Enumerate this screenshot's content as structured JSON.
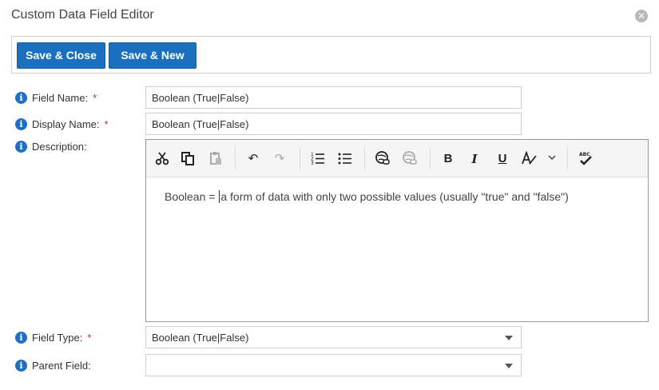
{
  "dialog": {
    "title": "Custom Data Field Editor",
    "close_icon": "close-circle-icon"
  },
  "toolbar": {
    "save_close_label": "Save & Close",
    "save_new_label": "Save & New"
  },
  "form": {
    "field_name": {
      "label": "Field Name:",
      "required_mark": "*",
      "value": "Boolean (True|False)"
    },
    "display_name": {
      "label": "Display Name:",
      "required_mark": "*",
      "value": "Boolean (True|False)"
    },
    "description": {
      "label": "Description:",
      "content_before_caret": "Boolean = ",
      "content_after_caret": "a form of data with only two possible values (usually \"true\" and \"false\")"
    },
    "field_type": {
      "label": "Field Type:",
      "required_mark": "*",
      "selected": "Boolean (True|False)"
    },
    "parent_field": {
      "label": "Parent Field:",
      "selected": ""
    }
  },
  "editor_toolbar": {
    "spellcheck_text": "ABC",
    "icons": [
      "cut-icon",
      "copy-icon",
      "paste-icon",
      "undo-icon",
      "redo-icon",
      "numbered-list-icon",
      "bullet-list-icon",
      "link-icon",
      "unlink-icon",
      "bold-icon",
      "italic-icon",
      "underline-icon",
      "font-style-icon",
      "chevron-down-icon",
      "spellcheck-icon"
    ],
    "bold": "B",
    "italic": "I",
    "underline": "U"
  },
  "colors": {
    "primary_button": "#1a6fbf",
    "info_icon": "#1f6fc5",
    "required": "#d9262b"
  }
}
